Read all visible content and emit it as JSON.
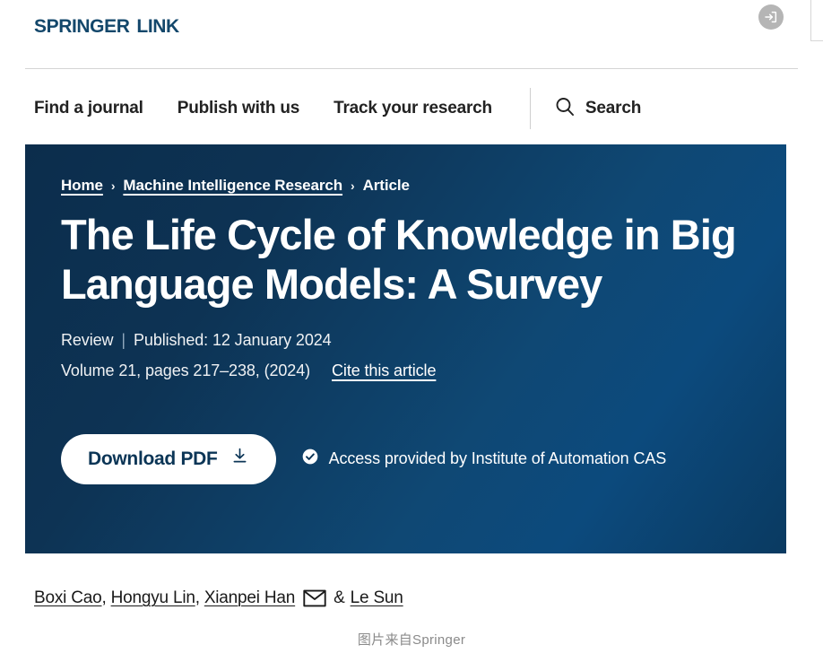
{
  "site": {
    "brand": "Springer Link",
    "login_icon": "login-icon"
  },
  "nav": {
    "items": [
      {
        "label": "Find a journal"
      },
      {
        "label": "Publish with us"
      },
      {
        "label": "Track your research"
      }
    ],
    "search_label": "Search",
    "search_icon": "search-icon"
  },
  "breadcrumb": {
    "home": "Home",
    "journal": "Machine Intelligence Research",
    "current": "Article",
    "separator": "›"
  },
  "article": {
    "title": "The Life Cycle of Knowledge in Big Language Models: A Survey",
    "type": "Review",
    "published_label": "Published: 12 January 2024",
    "volume_pages": "Volume 21, pages 217–238, (2024)",
    "cite_link": "Cite this article",
    "download_label": "Download PDF",
    "download_icon": "download-icon",
    "access_text": "Access provided by Institute of Automation CAS",
    "access_icon": "check-circle-icon"
  },
  "authors": {
    "list": [
      {
        "name": "Boxi Cao"
      },
      {
        "name": "Hongyu Lin"
      },
      {
        "name": "Xianpei Han"
      },
      {
        "name": "Le Sun"
      }
    ],
    "corresponding_icon": "envelope-icon",
    "ampersand": "&"
  },
  "caption": {
    "text": "图片来自Springer"
  },
  "colors": {
    "brand_navy": "#13476b",
    "hero_dark": "#0c2d4c",
    "hero_light": "#0c4a7d",
    "text_dark": "#1a1a1a",
    "caption_grey": "#8a8a8a"
  }
}
